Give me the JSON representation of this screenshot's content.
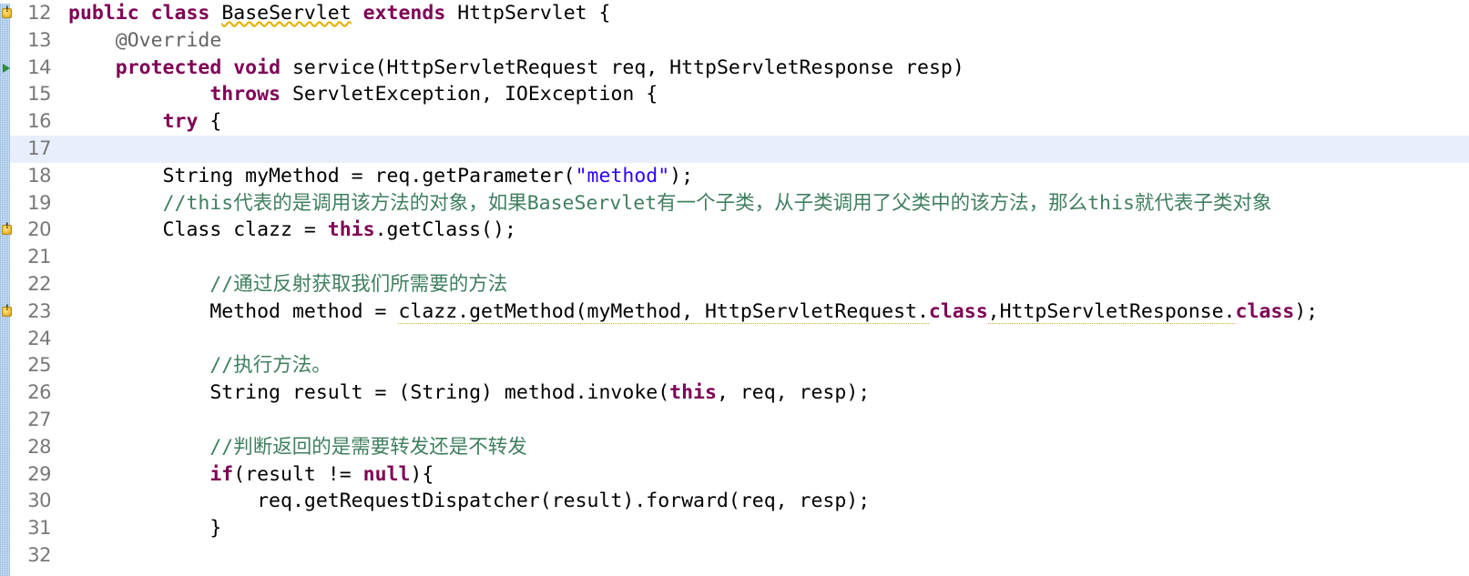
{
  "editor": {
    "app": "java-code-editor",
    "language": "Java",
    "current_line": 17,
    "colors": {
      "background": "#ffffff",
      "current_line_highlight": "#e8eefb",
      "keyword": "#7f0055",
      "string": "#2a00ff",
      "comment": "#3f7f5f",
      "annotation": "#646464",
      "line_number": "#787878",
      "warning_marker": "#f3c33c",
      "override_marker": "#2e8b36"
    },
    "gutter": {
      "first_line": 12,
      "last_line": 32
    }
  },
  "lines": [
    {
      "number": "12",
      "marker": "warning",
      "fold": false,
      "current": false,
      "tokens": [
        {
          "t": "public",
          "c": "kw"
        },
        {
          "t": " ",
          "c": "plain"
        },
        {
          "t": "class",
          "c": "kw"
        },
        {
          "t": " ",
          "c": "plain"
        },
        {
          "t": "BaseServlet",
          "c": "plain warn-underline"
        },
        {
          "t": " ",
          "c": "plain"
        },
        {
          "t": "extends",
          "c": "kw"
        },
        {
          "t": " ",
          "c": "plain"
        },
        {
          "t": "HttpServlet {",
          "c": "plain"
        }
      ]
    },
    {
      "number": "13",
      "marker": "",
      "fold": true,
      "current": false,
      "tokens": [
        {
          "t": "    ",
          "c": "plain"
        },
        {
          "t": "@Override",
          "c": "ann"
        }
      ]
    },
    {
      "number": "14",
      "marker": "override",
      "fold": false,
      "current": false,
      "tokens": [
        {
          "t": "    ",
          "c": "plain"
        },
        {
          "t": "protected",
          "c": "kw"
        },
        {
          "t": " ",
          "c": "plain"
        },
        {
          "t": "void",
          "c": "kw"
        },
        {
          "t": " service(HttpServletRequest req, HttpServletResponse resp)",
          "c": "plain"
        }
      ]
    },
    {
      "number": "15",
      "marker": "",
      "fold": false,
      "current": false,
      "tokens": [
        {
          "t": "            ",
          "c": "plain"
        },
        {
          "t": "throws",
          "c": "kw"
        },
        {
          "t": " ServletException, IOException {",
          "c": "plain"
        }
      ]
    },
    {
      "number": "16",
      "marker": "",
      "fold": false,
      "current": false,
      "tokens": [
        {
          "t": "        ",
          "c": "plain"
        },
        {
          "t": "try",
          "c": "kw"
        },
        {
          "t": " {",
          "c": "plain"
        }
      ]
    },
    {
      "number": "17",
      "marker": "",
      "fold": false,
      "current": true,
      "tokens": [
        {
          "t": "",
          "c": "plain"
        }
      ]
    },
    {
      "number": "18",
      "marker": "",
      "fold": false,
      "current": false,
      "tokens": [
        {
          "t": "        String myMethod = req.getParameter(",
          "c": "plain"
        },
        {
          "t": "\"method\"",
          "c": "str"
        },
        {
          "t": ");",
          "c": "plain"
        }
      ]
    },
    {
      "number": "19",
      "marker": "",
      "fold": false,
      "current": false,
      "tokens": [
        {
          "t": "        ",
          "c": "plain"
        },
        {
          "t": "//this代表的是调用该方法的对象，如果BaseServlet有一个子类，从子类调用了父类中的该方法，那么this就代表子类对象",
          "c": "cmt"
        }
      ]
    },
    {
      "number": "20",
      "marker": "warning",
      "fold": false,
      "current": false,
      "tokens": [
        {
          "t": "        Class clazz = ",
          "c": "plain"
        },
        {
          "t": "this",
          "c": "kw"
        },
        {
          "t": ".getClass();",
          "c": "plain"
        }
      ]
    },
    {
      "number": "21",
      "marker": "",
      "fold": false,
      "current": false,
      "tokens": [
        {
          "t": "",
          "c": "plain"
        }
      ]
    },
    {
      "number": "22",
      "marker": "",
      "fold": false,
      "current": false,
      "tokens": [
        {
          "t": "            ",
          "c": "plain"
        },
        {
          "t": "//通过反射获取我们所需要的方法",
          "c": "cmt"
        }
      ]
    },
    {
      "number": "23",
      "marker": "warning",
      "fold": false,
      "current": false,
      "tokens": [
        {
          "t": "            Method method = ",
          "c": "plain"
        },
        {
          "t": "clazz.getMethod(myMethod, HttpServletRequest.",
          "c": "plain spell-underline"
        },
        {
          "t": "class",
          "c": "kw"
        },
        {
          "t": ",HttpServletResponse.",
          "c": "plain spell-underline"
        },
        {
          "t": "class",
          "c": "kw"
        },
        {
          "t": ");",
          "c": "plain"
        }
      ]
    },
    {
      "number": "24",
      "marker": "",
      "fold": false,
      "current": false,
      "tokens": [
        {
          "t": "",
          "c": "plain"
        }
      ]
    },
    {
      "number": "25",
      "marker": "",
      "fold": false,
      "current": false,
      "tokens": [
        {
          "t": "            ",
          "c": "plain"
        },
        {
          "t": "//执行方法。",
          "c": "cmt"
        }
      ]
    },
    {
      "number": "26",
      "marker": "",
      "fold": false,
      "current": false,
      "tokens": [
        {
          "t": "            String result = (String) method.invoke(",
          "c": "plain"
        },
        {
          "t": "this",
          "c": "kw"
        },
        {
          "t": ", req, resp);",
          "c": "plain"
        }
      ]
    },
    {
      "number": "27",
      "marker": "",
      "fold": false,
      "current": false,
      "tokens": [
        {
          "t": "",
          "c": "plain"
        }
      ]
    },
    {
      "number": "28",
      "marker": "",
      "fold": false,
      "current": false,
      "tokens": [
        {
          "t": "            ",
          "c": "plain"
        },
        {
          "t": "//判断返回的是需要转发还是不转发",
          "c": "cmt"
        }
      ]
    },
    {
      "number": "29",
      "marker": "",
      "fold": false,
      "current": false,
      "tokens": [
        {
          "t": "            ",
          "c": "plain"
        },
        {
          "t": "if",
          "c": "kw"
        },
        {
          "t": "(result != ",
          "c": "plain"
        },
        {
          "t": "null",
          "c": "kw"
        },
        {
          "t": "){",
          "c": "plain"
        }
      ]
    },
    {
      "number": "30",
      "marker": "",
      "fold": false,
      "current": false,
      "tokens": [
        {
          "t": "                req.getRequestDispatcher(result).forward(req, resp);",
          "c": "plain"
        }
      ]
    },
    {
      "number": "31",
      "marker": "",
      "fold": false,
      "current": false,
      "tokens": [
        {
          "t": "            }",
          "c": "plain"
        }
      ]
    },
    {
      "number": "32",
      "marker": "",
      "fold": false,
      "current": false,
      "tokens": [
        {
          "t": "",
          "c": "plain"
        }
      ]
    }
  ]
}
